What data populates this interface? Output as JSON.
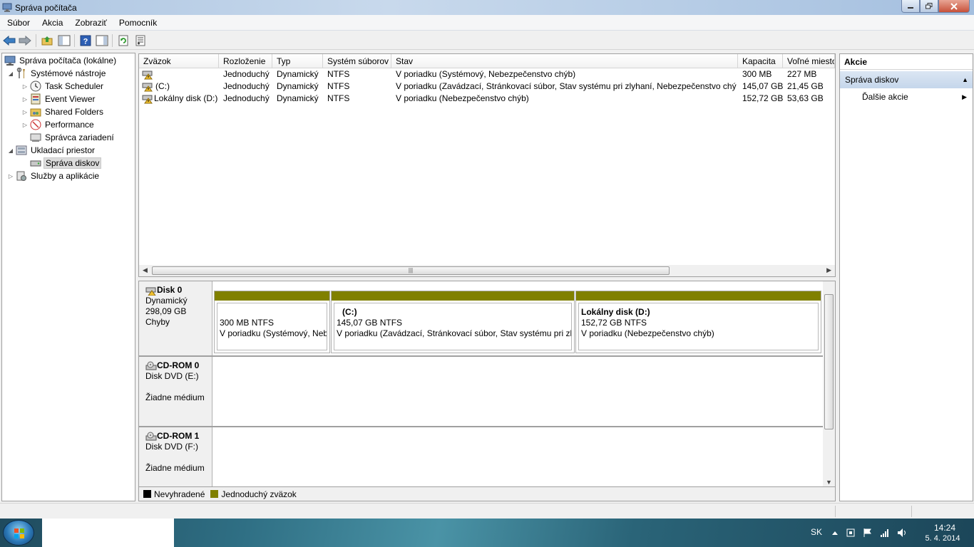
{
  "window": {
    "title": "Správa počítača"
  },
  "menubar": [
    "Súbor",
    "Akcia",
    "Zobraziť",
    "Pomocník"
  ],
  "tree": {
    "root": "Správa počítača (lokálne)",
    "system_tools": "Systémové nástroje",
    "task_scheduler": "Task Scheduler",
    "event_viewer": "Event Viewer",
    "shared_folders": "Shared Folders",
    "performance": "Performance",
    "device_manager": "Správca zariadení",
    "storage": "Ukladací priestor",
    "disk_management": "Správa diskov",
    "services": "Služby a aplikácie"
  },
  "volumes": {
    "columns": [
      "Zväzok",
      "Rozloženie",
      "Typ",
      "Systém súborov",
      "Stav",
      "Kapacita",
      "Voľné miesto"
    ],
    "rows": [
      {
        "name": "",
        "layout": "Jednoduchý",
        "type": "Dynamický",
        "fs": "NTFS",
        "status": "V poriadku (Systémový, Nebezpečenstvo chýb)",
        "capacity": "300 MB",
        "free": "227 MB"
      },
      {
        "name": "(C:)",
        "layout": "Jednoduchý",
        "type": "Dynamický",
        "fs": "NTFS",
        "status": "V poriadku (Zavádzací, Stránkovací súbor, Stav systému pri zlyhaní, Nebezpečenstvo chýb)",
        "capacity": "145,07 GB",
        "free": "21,45 GB"
      },
      {
        "name": "Lokálny disk (D:)",
        "layout": "Jednoduchý",
        "type": "Dynamický",
        "fs": "NTFS",
        "status": "V poriadku (Nebezpečenstvo chýb)",
        "capacity": "152,72 GB",
        "free": "53,63 GB"
      }
    ]
  },
  "disks": [
    {
      "name": "Disk 0",
      "line1": "Dynamický",
      "line2": "298,09 GB",
      "line3": "Chyby",
      "partitions": [
        {
          "title": "",
          "size": "300 MB NTFS",
          "status": "V poriadku (Systémový, Nebezpečenstvo chýb)"
        },
        {
          "title": "(C:)",
          "size": "145,07 GB NTFS",
          "status": "V poriadku (Zavádzací, Stránkovací súbor, Stav systému pri zlyhaní, Nebezpečenstvo chýb)"
        },
        {
          "title": "Lokálny disk  (D:)",
          "size": "152,72 GB NTFS",
          "status": "V poriadku (Nebezpečenstvo chýb)"
        }
      ]
    },
    {
      "name": "CD-ROM 0",
      "line1": "Disk DVD (E:)",
      "line2": "",
      "line3": "Žiadne médium"
    },
    {
      "name": "CD-ROM 1",
      "line1": "Disk DVD (F:)",
      "line2": "",
      "line3": "Žiadne médium"
    }
  ],
  "legend": [
    {
      "label": "Nevyhradené",
      "color": "#000000"
    },
    {
      "label": "Jednoduchý zväzok",
      "color": "#808000"
    }
  ],
  "actions": {
    "header": "Akcie",
    "group": "Správa diskov",
    "item": "Ďalšie akcie"
  },
  "taskbar": {
    "lang": "SK",
    "time": "14:24",
    "date": "5. 4. 2014"
  },
  "colors": {
    "simple_volume": "#808000",
    "unallocated": "#000000",
    "selection": "#dcdcdc"
  }
}
